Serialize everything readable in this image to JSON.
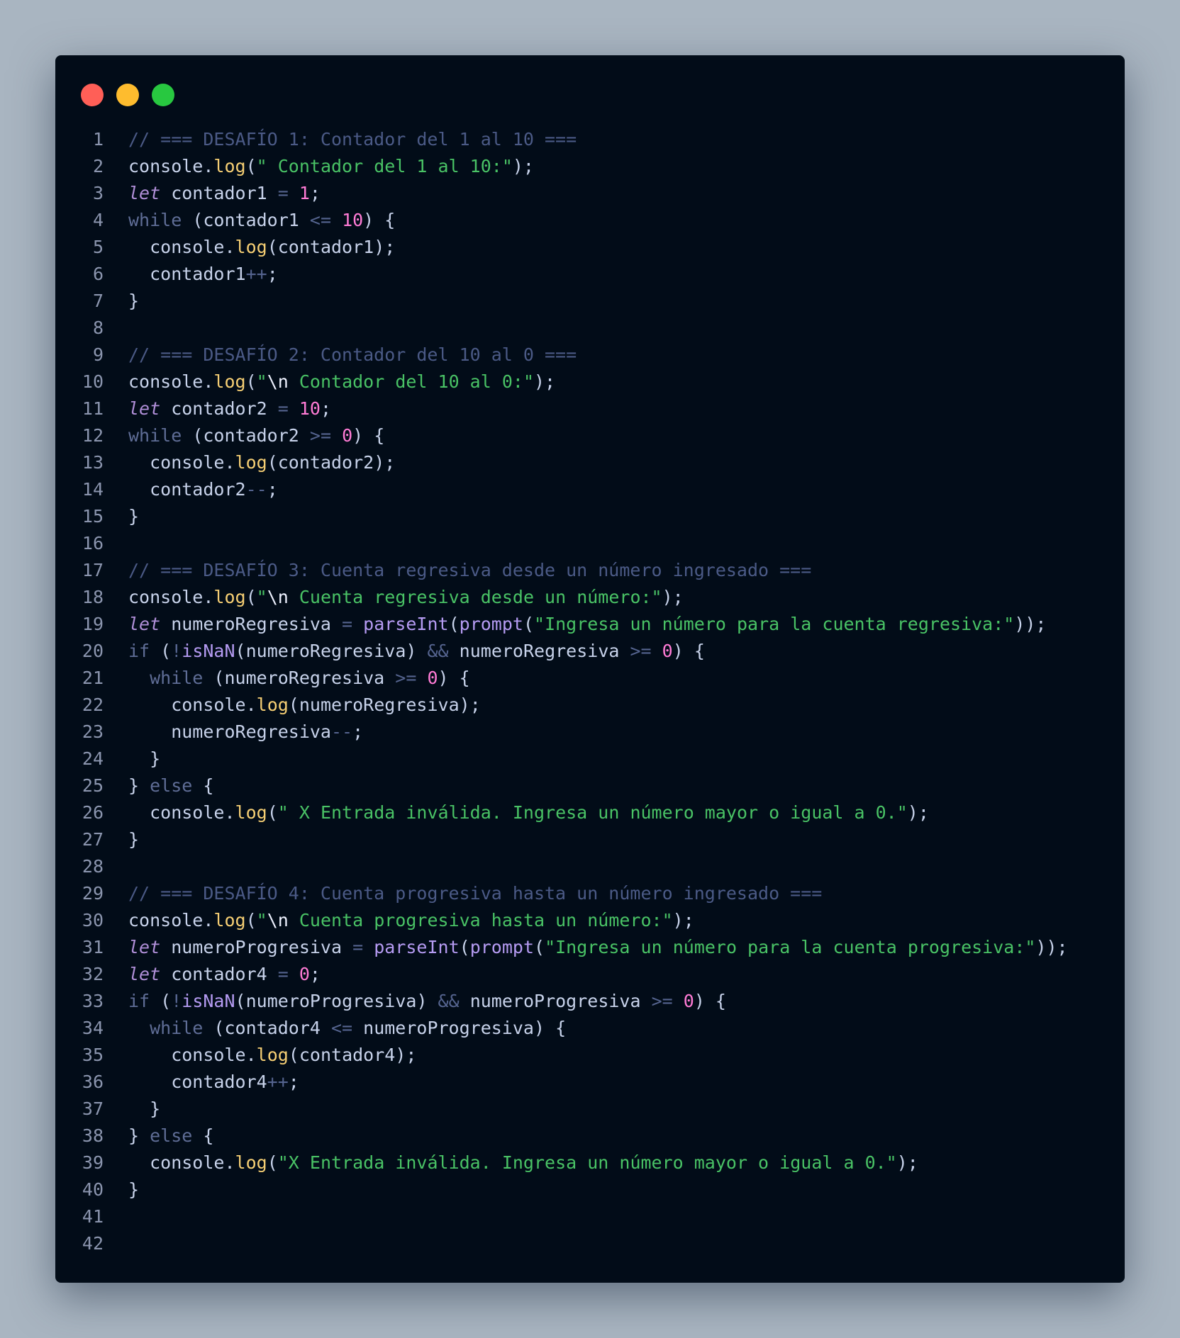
{
  "window": {
    "controls": {
      "close": "#ff5f57",
      "minimize": "#febc2e",
      "maximize": "#28c840"
    }
  },
  "code": {
    "language": "javascript",
    "lines": [
      [
        [
          "comment",
          "// === DESAFÍO 1: Contador del 1 al 10 ==="
        ]
      ],
      [
        [
          "var",
          "console"
        ],
        [
          "punc",
          "."
        ],
        [
          "fn",
          "log"
        ],
        [
          "punc",
          "("
        ],
        [
          "str",
          "\" Contador del 1 al 10:\""
        ],
        [
          "punc",
          ");"
        ]
      ],
      [
        [
          "let",
          "let"
        ],
        [
          "var",
          " contador1 "
        ],
        [
          "op",
          "="
        ],
        [
          "var",
          " "
        ],
        [
          "num",
          "1"
        ],
        [
          "punc",
          ";"
        ]
      ],
      [
        [
          "kw",
          "while"
        ],
        [
          "punc",
          " ("
        ],
        [
          "var",
          "contador1 "
        ],
        [
          "op",
          "<="
        ],
        [
          "var",
          " "
        ],
        [
          "num",
          "10"
        ],
        [
          "punc",
          ") {"
        ]
      ],
      [
        [
          "var",
          "  console"
        ],
        [
          "punc",
          "."
        ],
        [
          "fn",
          "log"
        ],
        [
          "punc",
          "("
        ],
        [
          "var",
          "contador1"
        ],
        [
          "punc",
          ");"
        ]
      ],
      [
        [
          "var",
          "  contador1"
        ],
        [
          "op",
          "++"
        ],
        [
          "punc",
          ";"
        ]
      ],
      [
        [
          "punc",
          "}"
        ]
      ],
      [],
      [
        [
          "comment",
          "// === DESAFÍO 2: Contador del 10 al 0 ==="
        ]
      ],
      [
        [
          "var",
          "console"
        ],
        [
          "punc",
          "."
        ],
        [
          "fn",
          "log"
        ],
        [
          "punc",
          "("
        ],
        [
          "str",
          "\""
        ],
        [
          "esc",
          "\\n"
        ],
        [
          "str",
          " Contador del 10 al 0:\""
        ],
        [
          "punc",
          ");"
        ]
      ],
      [
        [
          "let",
          "let"
        ],
        [
          "var",
          " contador2 "
        ],
        [
          "op",
          "="
        ],
        [
          "var",
          " "
        ],
        [
          "num",
          "10"
        ],
        [
          "punc",
          ";"
        ]
      ],
      [
        [
          "kw",
          "while"
        ],
        [
          "punc",
          " ("
        ],
        [
          "var",
          "contador2 "
        ],
        [
          "op",
          ">="
        ],
        [
          "var",
          " "
        ],
        [
          "num",
          "0"
        ],
        [
          "punc",
          ") {"
        ]
      ],
      [
        [
          "var",
          "  console"
        ],
        [
          "punc",
          "."
        ],
        [
          "fn",
          "log"
        ],
        [
          "punc",
          "("
        ],
        [
          "var",
          "contador2"
        ],
        [
          "punc",
          ");"
        ]
      ],
      [
        [
          "var",
          "  contador2"
        ],
        [
          "op",
          "--"
        ],
        [
          "punc",
          ";"
        ]
      ],
      [
        [
          "punc",
          "}"
        ]
      ],
      [],
      [
        [
          "comment",
          "// === DESAFÍO 3: Cuenta regresiva desde un número ingresado ==="
        ]
      ],
      [
        [
          "var",
          "console"
        ],
        [
          "punc",
          "."
        ],
        [
          "fn",
          "log"
        ],
        [
          "punc",
          "("
        ],
        [
          "str",
          "\""
        ],
        [
          "esc",
          "\\n"
        ],
        [
          "str",
          " Cuenta regresiva desde un número:\""
        ],
        [
          "punc",
          ");"
        ]
      ],
      [
        [
          "let",
          "let"
        ],
        [
          "var",
          " numeroRegresiva "
        ],
        [
          "op",
          "="
        ],
        [
          "var",
          " "
        ],
        [
          "builtin",
          "parseInt"
        ],
        [
          "punc",
          "("
        ],
        [
          "builtin",
          "prompt"
        ],
        [
          "punc",
          "("
        ],
        [
          "str",
          "\"Ingresa un número para la cuenta regresiva:\""
        ],
        [
          "punc",
          "));"
        ]
      ],
      [
        [
          "kw",
          "if"
        ],
        [
          "punc",
          " ("
        ],
        [
          "op",
          "!"
        ],
        [
          "builtin",
          "isNaN"
        ],
        [
          "punc",
          "("
        ],
        [
          "var",
          "numeroRegresiva"
        ],
        [
          "punc",
          ") "
        ],
        [
          "op",
          "&&"
        ],
        [
          "var",
          " numeroRegresiva "
        ],
        [
          "op",
          ">="
        ],
        [
          "var",
          " "
        ],
        [
          "num",
          "0"
        ],
        [
          "punc",
          ") {"
        ]
      ],
      [
        [
          "kw",
          "  while"
        ],
        [
          "punc",
          " ("
        ],
        [
          "var",
          "numeroRegresiva "
        ],
        [
          "op",
          ">="
        ],
        [
          "var",
          " "
        ],
        [
          "num",
          "0"
        ],
        [
          "punc",
          ") {"
        ]
      ],
      [
        [
          "var",
          "    console"
        ],
        [
          "punc",
          "."
        ],
        [
          "fn",
          "log"
        ],
        [
          "punc",
          "("
        ],
        [
          "var",
          "numeroRegresiva"
        ],
        [
          "punc",
          ");"
        ]
      ],
      [
        [
          "var",
          "    numeroRegresiva"
        ],
        [
          "op",
          "--"
        ],
        [
          "punc",
          ";"
        ]
      ],
      [
        [
          "punc",
          "  }"
        ]
      ],
      [
        [
          "punc",
          "} "
        ],
        [
          "kw",
          "else"
        ],
        [
          "punc",
          " {"
        ]
      ],
      [
        [
          "var",
          "  console"
        ],
        [
          "punc",
          "."
        ],
        [
          "fn",
          "log"
        ],
        [
          "punc",
          "("
        ],
        [
          "str",
          "\" X Entrada inválida. Ingresa un número mayor o igual a 0.\""
        ],
        [
          "punc",
          ");"
        ]
      ],
      [
        [
          "punc",
          "}"
        ]
      ],
      [],
      [
        [
          "comment",
          "// === DESAFÍO 4: Cuenta progresiva hasta un número ingresado ==="
        ]
      ],
      [
        [
          "var",
          "console"
        ],
        [
          "punc",
          "."
        ],
        [
          "fn",
          "log"
        ],
        [
          "punc",
          "("
        ],
        [
          "str",
          "\""
        ],
        [
          "esc",
          "\\n"
        ],
        [
          "str",
          " Cuenta progresiva hasta un número:\""
        ],
        [
          "punc",
          ");"
        ]
      ],
      [
        [
          "let",
          "let"
        ],
        [
          "var",
          " numeroProgresiva "
        ],
        [
          "op",
          "="
        ],
        [
          "var",
          " "
        ],
        [
          "builtin",
          "parseInt"
        ],
        [
          "punc",
          "("
        ],
        [
          "builtin",
          "prompt"
        ],
        [
          "punc",
          "("
        ],
        [
          "str",
          "\"Ingresa un número para la cuenta progresiva:\""
        ],
        [
          "punc",
          "));"
        ]
      ],
      [
        [
          "let",
          "let"
        ],
        [
          "var",
          " contador4 "
        ],
        [
          "op",
          "="
        ],
        [
          "var",
          " "
        ],
        [
          "num",
          "0"
        ],
        [
          "punc",
          ";"
        ]
      ],
      [
        [
          "kw",
          "if"
        ],
        [
          "punc",
          " ("
        ],
        [
          "op",
          "!"
        ],
        [
          "builtin",
          "isNaN"
        ],
        [
          "punc",
          "("
        ],
        [
          "var",
          "numeroProgresiva"
        ],
        [
          "punc",
          ") "
        ],
        [
          "op",
          "&&"
        ],
        [
          "var",
          " numeroProgresiva "
        ],
        [
          "op",
          ">="
        ],
        [
          "var",
          " "
        ],
        [
          "num",
          "0"
        ],
        [
          "punc",
          ") {"
        ]
      ],
      [
        [
          "kw",
          "  while"
        ],
        [
          "punc",
          " ("
        ],
        [
          "var",
          "contador4 "
        ],
        [
          "op",
          "<="
        ],
        [
          "var",
          " numeroProgresiva"
        ],
        [
          "punc",
          ") {"
        ]
      ],
      [
        [
          "var",
          "    console"
        ],
        [
          "punc",
          "."
        ],
        [
          "fn",
          "log"
        ],
        [
          "punc",
          "("
        ],
        [
          "var",
          "contador4"
        ],
        [
          "punc",
          ");"
        ]
      ],
      [
        [
          "var",
          "    contador4"
        ],
        [
          "op",
          "++"
        ],
        [
          "punc",
          ";"
        ]
      ],
      [
        [
          "punc",
          "  }"
        ]
      ],
      [
        [
          "punc",
          "} "
        ],
        [
          "kw",
          "else"
        ],
        [
          "punc",
          " {"
        ]
      ],
      [
        [
          "var",
          "  console"
        ],
        [
          "punc",
          "."
        ],
        [
          "fn",
          "log"
        ],
        [
          "punc",
          "("
        ],
        [
          "str",
          "\"X Entrada inválida. Ingresa un número mayor o igual a 0.\""
        ],
        [
          "punc",
          ");"
        ]
      ],
      [
        [
          "punc",
          "}"
        ]
      ],
      [],
      []
    ]
  }
}
